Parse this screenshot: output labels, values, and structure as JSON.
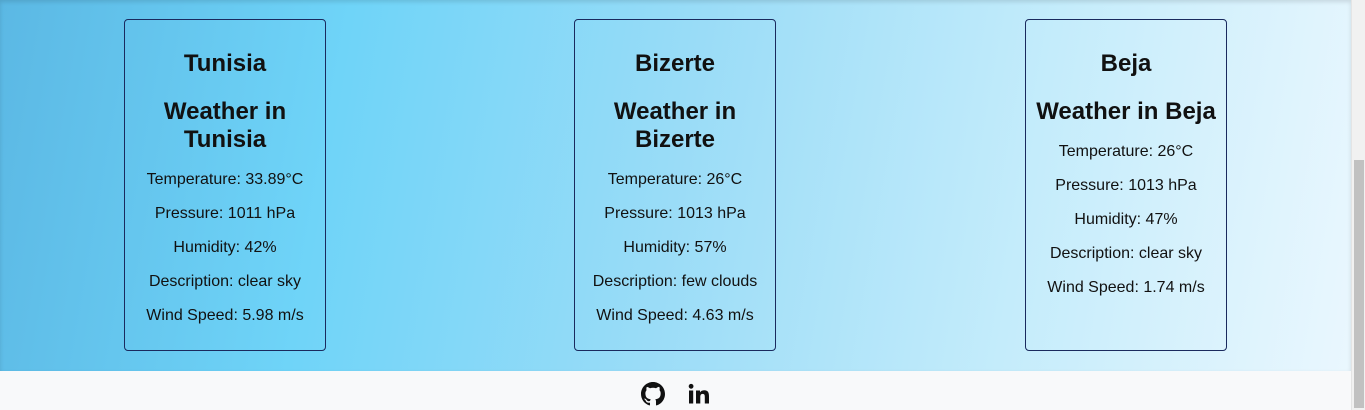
{
  "cards": [
    {
      "city": "Tunisia",
      "heading": "Weather in Tunisia",
      "temperature": "Temperature: 33.89°C",
      "pressure": "Pressure: 1011 hPa",
      "humidity": "Humidity: 42%",
      "description": "Description: clear sky",
      "wind": "Wind Speed: 5.98 m/s"
    },
    {
      "city": "Bizerte",
      "heading": "Weather in Bizerte",
      "temperature": "Temperature: 26°C",
      "pressure": "Pressure: 1013 hPa",
      "humidity": "Humidity: 57%",
      "description": "Description: few clouds",
      "wind": "Wind Speed: 4.63 m/s"
    },
    {
      "city": "Beja",
      "heading": "Weather in Beja",
      "temperature": "Temperature: 26°C",
      "pressure": "Pressure: 1013 hPa",
      "humidity": "Humidity: 47%",
      "description": "Description: clear sky",
      "wind": "Wind Speed: 1.74 m/s"
    }
  ],
  "footer": {
    "icons": [
      "github-icon",
      "linkedin-icon"
    ]
  },
  "colors": {
    "card_border": "#1a2a5e",
    "footer_bg": "#f8f9fa",
    "text": "#111111"
  }
}
